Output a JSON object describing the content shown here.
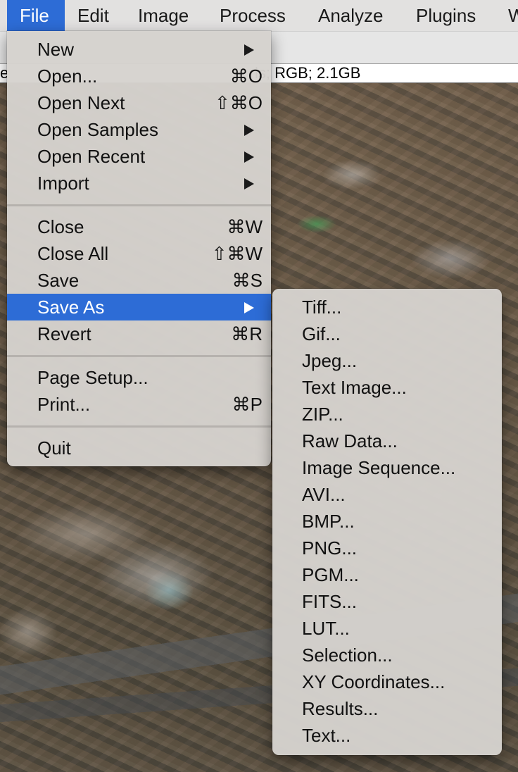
{
  "menubar": {
    "items": [
      "File",
      "Edit",
      "Image",
      "Process",
      "Analyze",
      "Plugins",
      "W"
    ]
  },
  "image_info": {
    "left_fragment": "e",
    "right_fragment": "ls; RGB; 2.1GB"
  },
  "file_menu": {
    "items": [
      {
        "label": "New",
        "shortcut": "",
        "submenu": true
      },
      {
        "label": "Open...",
        "shortcut": "⌘O",
        "submenu": false
      },
      {
        "label": "Open Next",
        "shortcut": "⇧⌘O",
        "submenu": false
      },
      {
        "label": "Open Samples",
        "shortcut": "",
        "submenu": true
      },
      {
        "label": "Open Recent",
        "shortcut": "",
        "submenu": true
      },
      {
        "label": "Import",
        "shortcut": "",
        "submenu": true
      },
      {
        "label": "Close",
        "shortcut": "⌘W",
        "submenu": false
      },
      {
        "label": "Close All",
        "shortcut": "⇧⌘W",
        "submenu": false
      },
      {
        "label": "Save",
        "shortcut": "⌘S",
        "submenu": false
      },
      {
        "label": "Save As",
        "shortcut": "",
        "submenu": true,
        "highlighted": true
      },
      {
        "label": "Revert",
        "shortcut": "⌘R",
        "submenu": false
      },
      {
        "label": "Page Setup...",
        "shortcut": "",
        "submenu": false
      },
      {
        "label": "Print...",
        "shortcut": "⌘P",
        "submenu": false
      },
      {
        "label": "Quit",
        "shortcut": "",
        "submenu": false
      }
    ]
  },
  "save_as_menu": {
    "items": [
      "Tiff...",
      "Gif...",
      "Jpeg...",
      "Text Image...",
      "ZIP...",
      "Raw Data...",
      "Image Sequence...",
      "AVI...",
      "BMP...",
      "PNG...",
      "PGM...",
      "FITS...",
      "LUT...",
      "Selection...",
      "XY Coordinates...",
      "Results...",
      "Text..."
    ]
  },
  "colors": {
    "highlight": "#2d6cd6",
    "menu_background": "#d6d2ce",
    "menubar_background": "#e2e1e0"
  },
  "icons": {
    "submenu": "submenu-arrow-icon"
  }
}
